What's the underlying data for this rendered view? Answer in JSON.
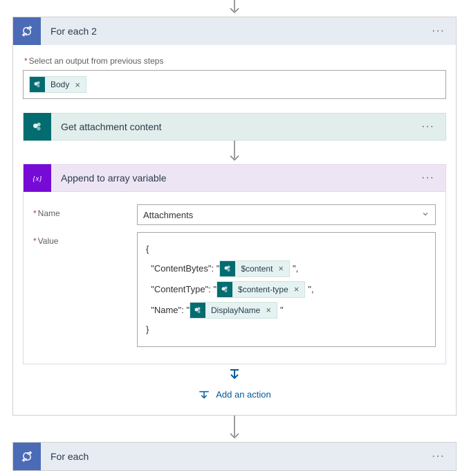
{
  "arrow": true,
  "foreach2": {
    "title": "For each 2",
    "select_output_label": "Select an output from previous steps",
    "body_token": "Body",
    "get_attachment": {
      "title": "Get attachment content"
    },
    "append": {
      "title": "Append to array variable",
      "name_label": "Name",
      "name_value": "Attachments",
      "value_label": "Value",
      "raw": {
        "open": "{",
        "line1_key": "\"ContentBytes\": \"",
        "line1_token": "$content",
        "line1_end": "\",",
        "line2_key": "\"ContentType\": \"",
        "line2_token": "$content-type",
        "line2_end": "\",",
        "line3_key": "\"Name\": \"",
        "line3_token": "DisplayName",
        "line3_end": "\"",
        "close": "}"
      }
    },
    "add_action": "Add an action"
  },
  "foreach": {
    "title": "For each"
  }
}
